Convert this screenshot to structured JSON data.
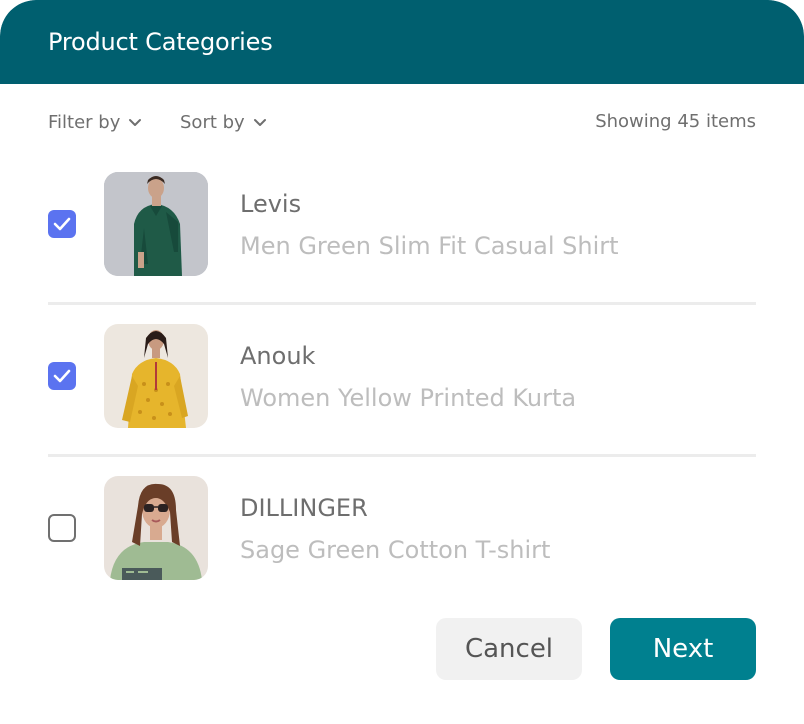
{
  "header": {
    "title": "Product Categories"
  },
  "toolbar": {
    "filter_label": "Filter by",
    "sort_label": "Sort by",
    "count_label": "Showing 45 items"
  },
  "items": [
    {
      "brand": "Levis",
      "description": "Men Green Slim Fit Casual Shirt",
      "checked": true
    },
    {
      "brand": "Anouk",
      "description": "Women Yellow Printed Kurta",
      "checked": true
    },
    {
      "brand": "DILLINGER",
      "description": "Sage Green Cotton T-shirt",
      "checked": false
    }
  ],
  "footer": {
    "cancel_label": "Cancel",
    "next_label": "Next"
  },
  "colors": {
    "header_bg": "#005f6f",
    "checkbox_checked": "#5b73f0",
    "primary_button": "#00808f",
    "secondary_button": "#f1f1f1"
  }
}
